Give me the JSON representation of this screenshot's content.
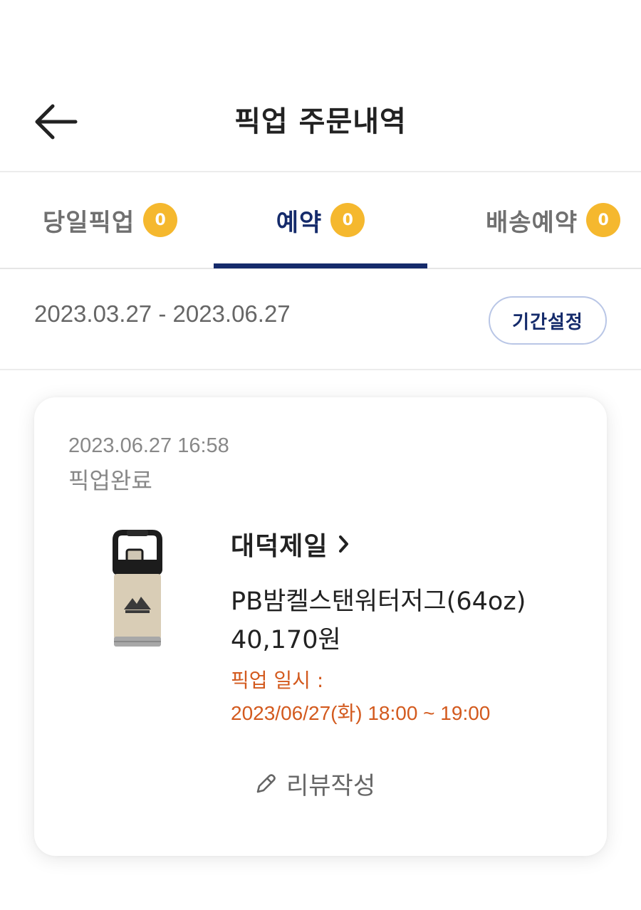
{
  "header": {
    "title": "픽업 주문내역",
    "back_icon": "arrow-left-icon"
  },
  "tabs": [
    {
      "label": "당일픽업",
      "count": "0",
      "active": false
    },
    {
      "label": "예약",
      "count": "0",
      "active": true
    },
    {
      "label": "배송예약",
      "count": "0",
      "active": false
    }
  ],
  "period": {
    "range": "2023.03.27 - 2023.06.27",
    "button_label": "기간설정"
  },
  "order": {
    "datetime": "2023.06.27 16:58",
    "status": "픽업완료",
    "store_name": "대덕제일",
    "product_name": "PB밤켈스탠워터저그(64oz)",
    "price": "40,170원",
    "pickup_label": "픽업 일시 :",
    "pickup_time": "2023/06/27(화) 18:00 ~ 19:00",
    "review_label": "리뷰작성"
  },
  "colors": {
    "accent_navy": "#152b6b",
    "badge_yellow": "#f5b82e",
    "pickup_orange": "#d35a1e"
  }
}
